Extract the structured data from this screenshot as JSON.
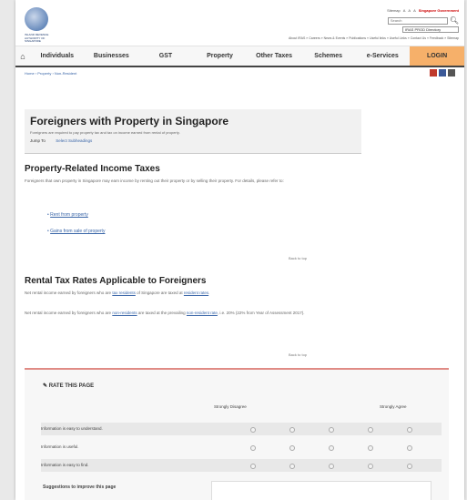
{
  "header": {
    "logo_text": "INLAND REVENUE AUTHORITY OF SINGAPORE",
    "util": [
      "Sitemap",
      "A",
      "A",
      "A"
    ],
    "gov_label": "Singapore Government",
    "search_placeholder": "Search",
    "select_value": "IRAS PROD Directory",
    "top_links": "About IRAS » Careers » News & Events » Publications » Useful links » Useful Links » Contact Us » Feedback » Sitemap"
  },
  "nav": {
    "items": [
      "Individuals",
      "Businesses",
      "GST",
      "Property",
      "Other Taxes",
      "Schemes",
      "e-Services"
    ],
    "login": "LOGIN"
  },
  "breadcrumb": "Home › Property › Non-Resident",
  "title_box": {
    "title": "Foreigners with Property in Singapore",
    "desc": "Foreigners are required to pay property tax and tax on income earned from rental of property.",
    "jump_label": "Jump To",
    "jump_value": "Select Subheadings"
  },
  "section1": {
    "heading": "Property-Related Income Taxes",
    "text": "Foreigners that own property in Singapore may earn income by renting out their property or by selling their property. For details, please refer to:",
    "links": [
      "Rent from property",
      "Gains from sale of property"
    ],
    "back_to_top": "Back to top"
  },
  "section2": {
    "heading": "Rental Tax Rates Applicable to Foreigners",
    "p1_pre": "Net rental income earned by foreigners who are ",
    "p1_link1": "tax residents",
    "p1_mid": " of Singapore are taxed at ",
    "p1_link2": "resident rates",
    "p1_end": ".",
    "p2_pre": "Net rental income earned by foreigners who are ",
    "p2_link1": "non-residents",
    "p2_mid": " are taxed at the prevailing ",
    "p2_link2": "non-resident rate",
    "p2_end": ", i.e. 20% (22% from Year of Assessment 2017).",
    "back_to_top": "Back to top"
  },
  "rate": {
    "heading": "RATE THIS PAGE",
    "col_left": "Strongly Disagree",
    "col_right": "Strongly Agree",
    "rows": [
      "Information is easy to understand.",
      "Information is useful.",
      "Information is easy to find."
    ],
    "suggestions": "Suggestions to improve this page"
  },
  "colors": {
    "nav_login": "#f6b06a",
    "link": "#3a66a8",
    "accent_border": "#e08b85"
  }
}
